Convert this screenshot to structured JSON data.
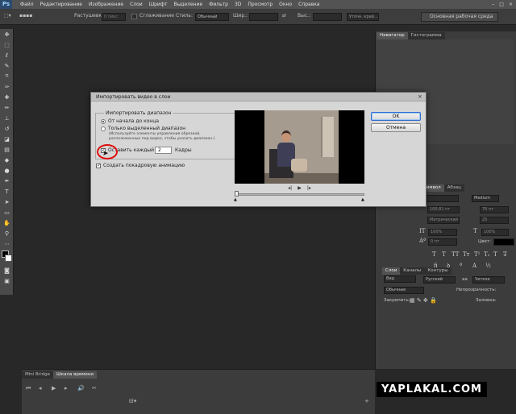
{
  "app": {
    "logo": "Ps"
  },
  "menu": [
    "Файл",
    "Редактирование",
    "Изображение",
    "Слои",
    "Шрифт",
    "Выделение",
    "Фильтр",
    "3D",
    "Просмотр",
    "Окно",
    "Справка"
  ],
  "window_controls": {
    "minimize": "–",
    "maximize": "□",
    "close": "×"
  },
  "options_bar": {
    "feather_label": "Растушевка:",
    "feather_value": "0 пикс",
    "antialias_label": "Сглаживание",
    "style_label": "Стиль:",
    "style_value": "Обычный",
    "width_label": "Шир.:",
    "height_label": "Выс.:",
    "refine_edge": "Уточн. край...",
    "workspace": "Основная рабочая среда"
  },
  "right_panels": {
    "navigator_tabs": [
      "Навигатор",
      "Гистограмма"
    ],
    "char_tabs": [
      "Символ",
      "Абзац"
    ],
    "char": {
      "font_style": "Medium",
      "size": "100,81 пт",
      "leading": "76 пт",
      "kerning": "Метрический",
      "tracking": "25",
      "vscale": "100%",
      "hscale": "100%",
      "baseline": "0 пт",
      "color_label": "Цвет:",
      "language": "Русский",
      "aa": "Четкое",
      "aa_glyph": "aa",
      "style_glyphs": [
        "T",
        "T",
        "TT",
        "Tт",
        "T¹",
        "T₁",
        "T",
        "T̶"
      ]
    },
    "layers_tabs": [
      "Слои",
      "Каналы",
      "Контуры"
    ],
    "layers": {
      "kind_label": "Вид",
      "blend": "Обычные",
      "opacity_label": "Непрозрачность:",
      "lock_label": "Закрепить:",
      "fill_label": "Заливка:"
    }
  },
  "bottom_tabs": [
    "Mini Bridge",
    "Шкала времени"
  ],
  "timeline_icons": [
    "⏮",
    "◂",
    "▶",
    "▸",
    "🔊",
    "✂",
    "+"
  ],
  "dialog": {
    "title": "Импортировать видео в слои",
    "close_glyph": "×",
    "group_label": "Импортировать диапазон",
    "option_all": "От начала до конца",
    "option_selected": "Только выделенный диапазон",
    "option_hint_1": "(Используйте элементы управления обрезкой,",
    "option_hint_2": "расположенные под видео, чтобы указать диапазон.)",
    "limit_label": "Оставить каждый",
    "limit_value": "2",
    "frames_label": "Кадры",
    "animation_label": "Создать покадровую анимацию",
    "ok": "OK",
    "cancel": "Отмена",
    "playback": [
      "◂|",
      "▶",
      "|▸"
    ]
  },
  "watermark": "YAPLAKAL.COM"
}
